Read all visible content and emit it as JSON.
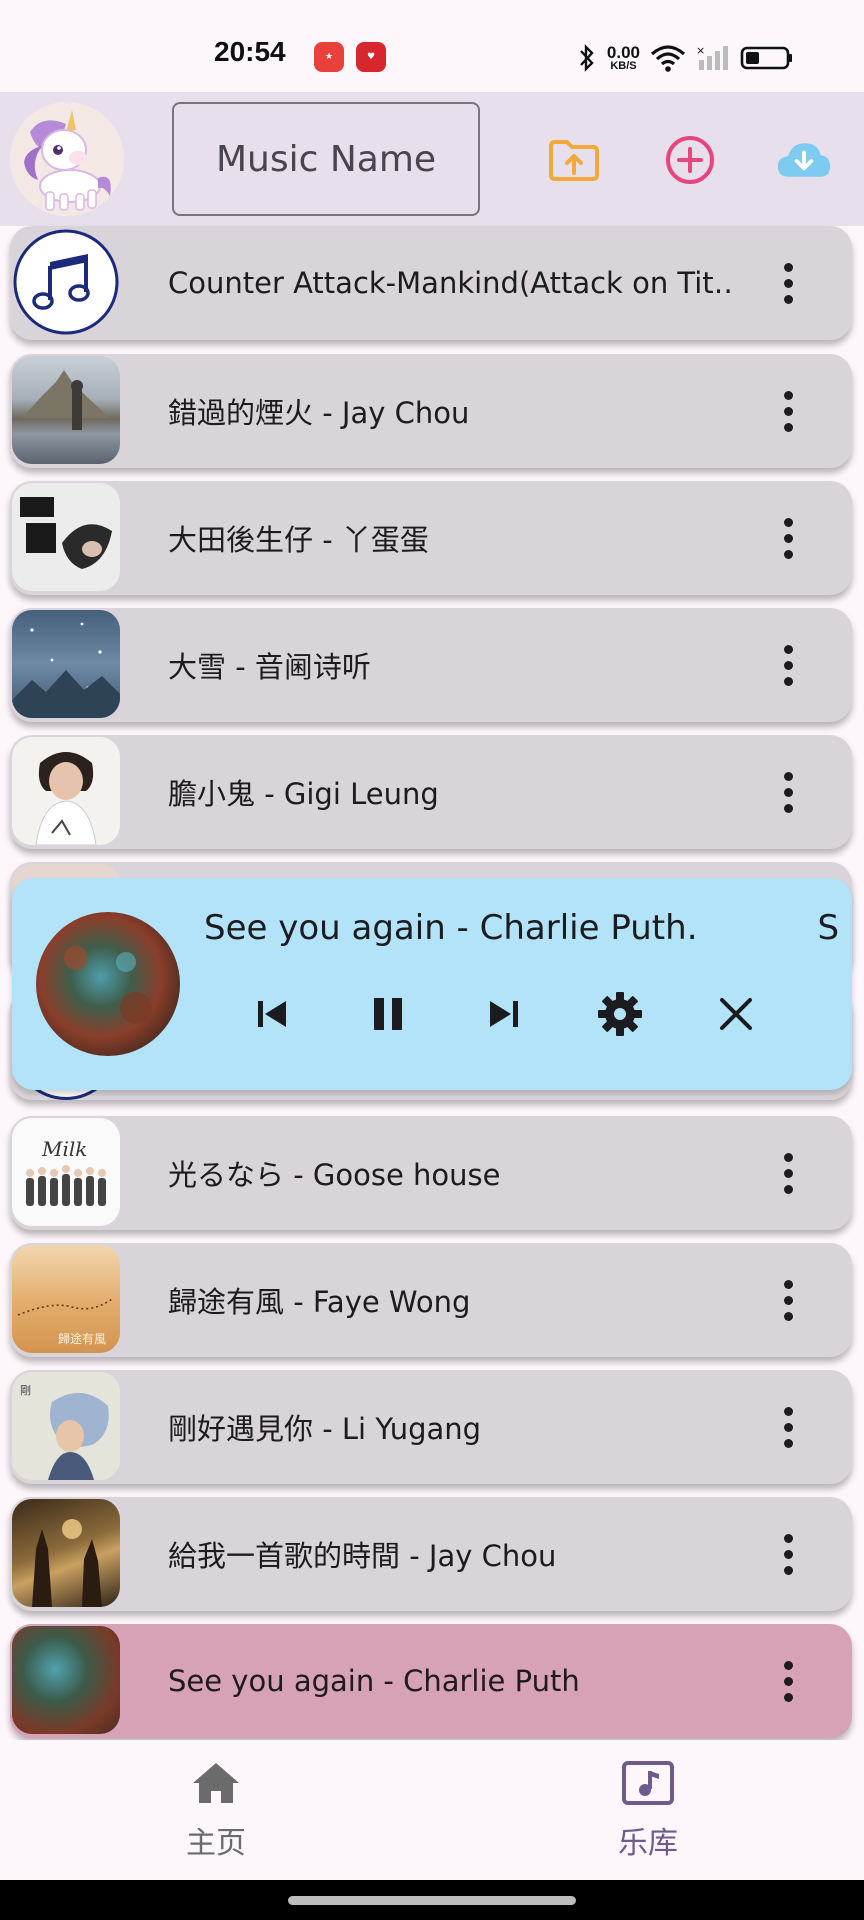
{
  "status_bar": {
    "time": "20:54",
    "net_speed": "0.00",
    "net_unit": "KB/S",
    "icons": [
      "bluetooth-icon",
      "wifi-icon",
      "signal-icon",
      "battery-icon"
    ]
  },
  "top_bar": {
    "search_placeholder": "Music Name",
    "icons": [
      "upload-folder-icon",
      "add-circle-icon",
      "cloud-download-icon"
    ],
    "colors": {
      "upload": "#F2A93B",
      "add": "#E8457E",
      "cloud": "#7DCBF0"
    }
  },
  "songs": [
    {
      "title": "Counter Attack-Mankind(Attack on Tit…",
      "art": "music-note-icon"
    },
    {
      "title": "錯過的煙火 - Jay Chou",
      "art": "album-art"
    },
    {
      "title": "大田後生仔 - 丫蛋蛋",
      "art": "album-art"
    },
    {
      "title": "大雪 - 音阃诗听",
      "art": "album-art"
    },
    {
      "title": "膽小鬼 - Gigi Leung",
      "art": "album-art"
    },
    {
      "title": "光るなら - Goose house",
      "art": "album-art"
    },
    {
      "title": "歸途有風 - Faye Wong",
      "art": "album-art"
    },
    {
      "title": "剛好遇見你 - Li Yugang",
      "art": "album-art"
    },
    {
      "title": "給我一首歌的時間 - Jay Chou",
      "art": "album-art"
    },
    {
      "title": "See you again - Charlie Puth",
      "art": "album-art",
      "active": true
    }
  ],
  "player": {
    "now_playing": "See you again - Charlie Puth.",
    "controls": [
      "skip-previous-icon",
      "pause-icon",
      "skip-next-icon",
      "settings-icon",
      "close-icon"
    ],
    "background": "#B3E3F8"
  },
  "bottom_nav": {
    "items": [
      {
        "label": "主页",
        "icon": "home-icon",
        "selected": false
      },
      {
        "label": "乐库",
        "icon": "music-library-icon",
        "selected": true
      }
    ],
    "selected_color": "#6E5A8C",
    "unselected_color": "#6B6B6B"
  }
}
